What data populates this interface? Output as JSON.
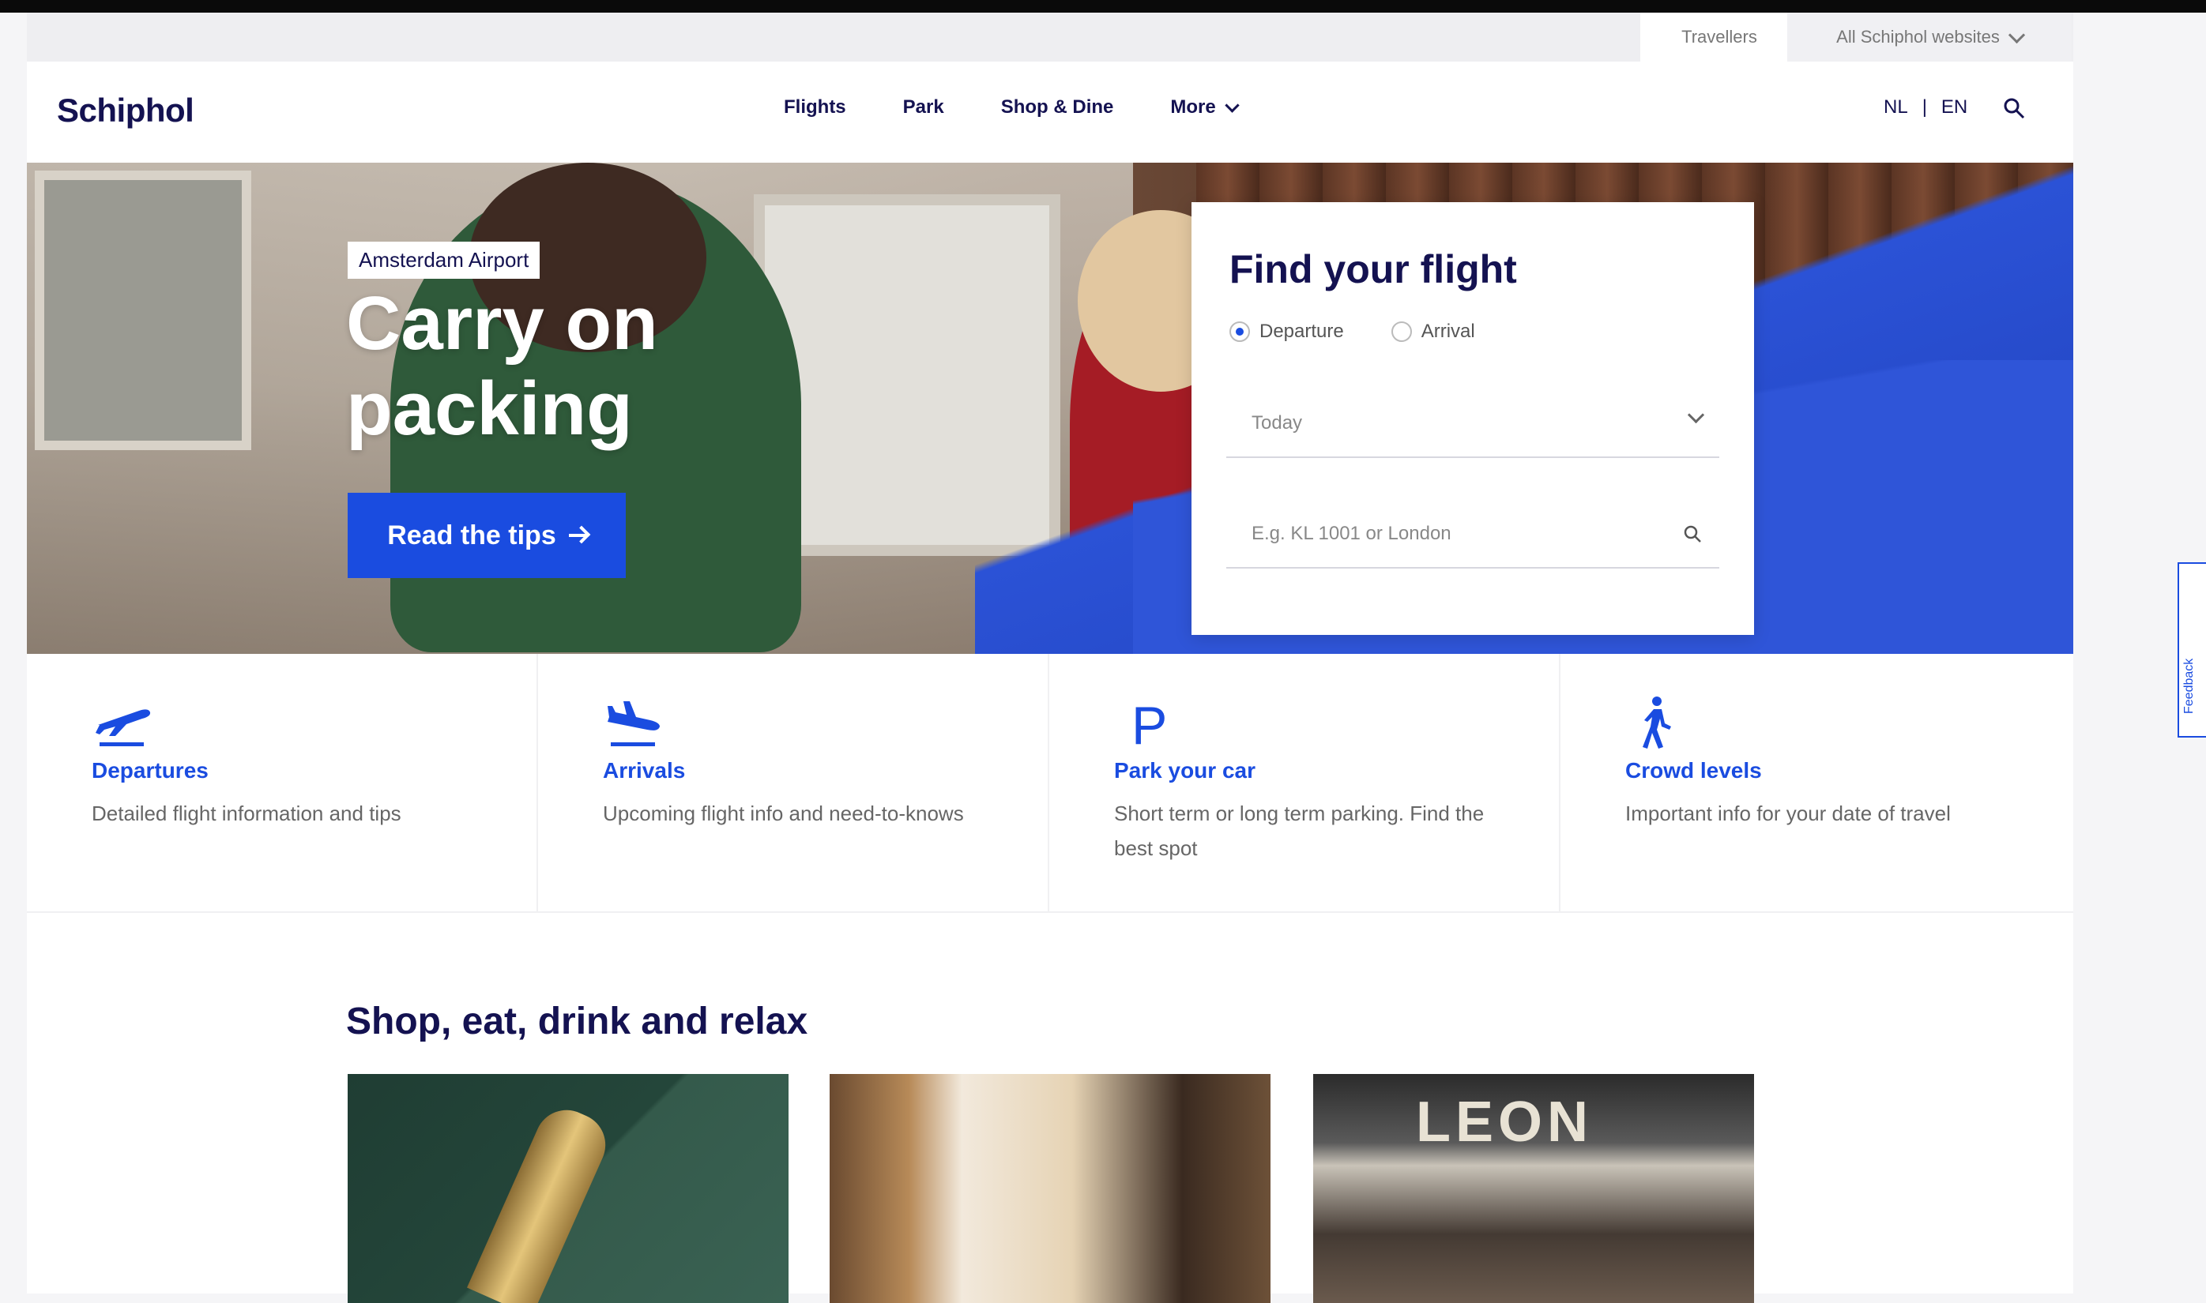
{
  "utility_bar": {
    "travellers_label": "Travellers",
    "sites_label": "All Schiphol websites"
  },
  "header": {
    "logo": "Schiphol",
    "nav": [
      "Flights",
      "Park",
      "Shop & Dine",
      "More"
    ],
    "lang": {
      "nl": "NL",
      "sep": "|",
      "en": "EN"
    }
  },
  "hero": {
    "badge": "Amsterdam Airport",
    "title_line1": "Carry on",
    "title_line2": "packing",
    "cta_label": "Read the tips"
  },
  "flight_search": {
    "title": "Find your flight",
    "radio_departure": "Departure",
    "radio_arrival": "Arrival",
    "selected": "departure",
    "date_value": "Today",
    "query_placeholder": "E.g. KL 1001 or London"
  },
  "quick_links": [
    {
      "icon": "plane-departure-icon",
      "title": "Departures",
      "text": "Detailed flight information and tips"
    },
    {
      "icon": "plane-arrival-icon",
      "title": "Arrivals",
      "text": "Upcoming flight info and need-to-knows"
    },
    {
      "icon": "parking-icon",
      "title": "Park your car",
      "text": "Short term or long term parking. Find the best spot"
    },
    {
      "icon": "walking-person-icon",
      "title": "Crowd levels",
      "text": "Important info for your date of travel"
    }
  ],
  "shop": {
    "title": "Shop, eat, drink and relax",
    "card3_sign": "LEON"
  },
  "feedback_tab": "Feedback",
  "colors": {
    "brand_blue": "#1a4ce0",
    "navy": "#141251"
  }
}
